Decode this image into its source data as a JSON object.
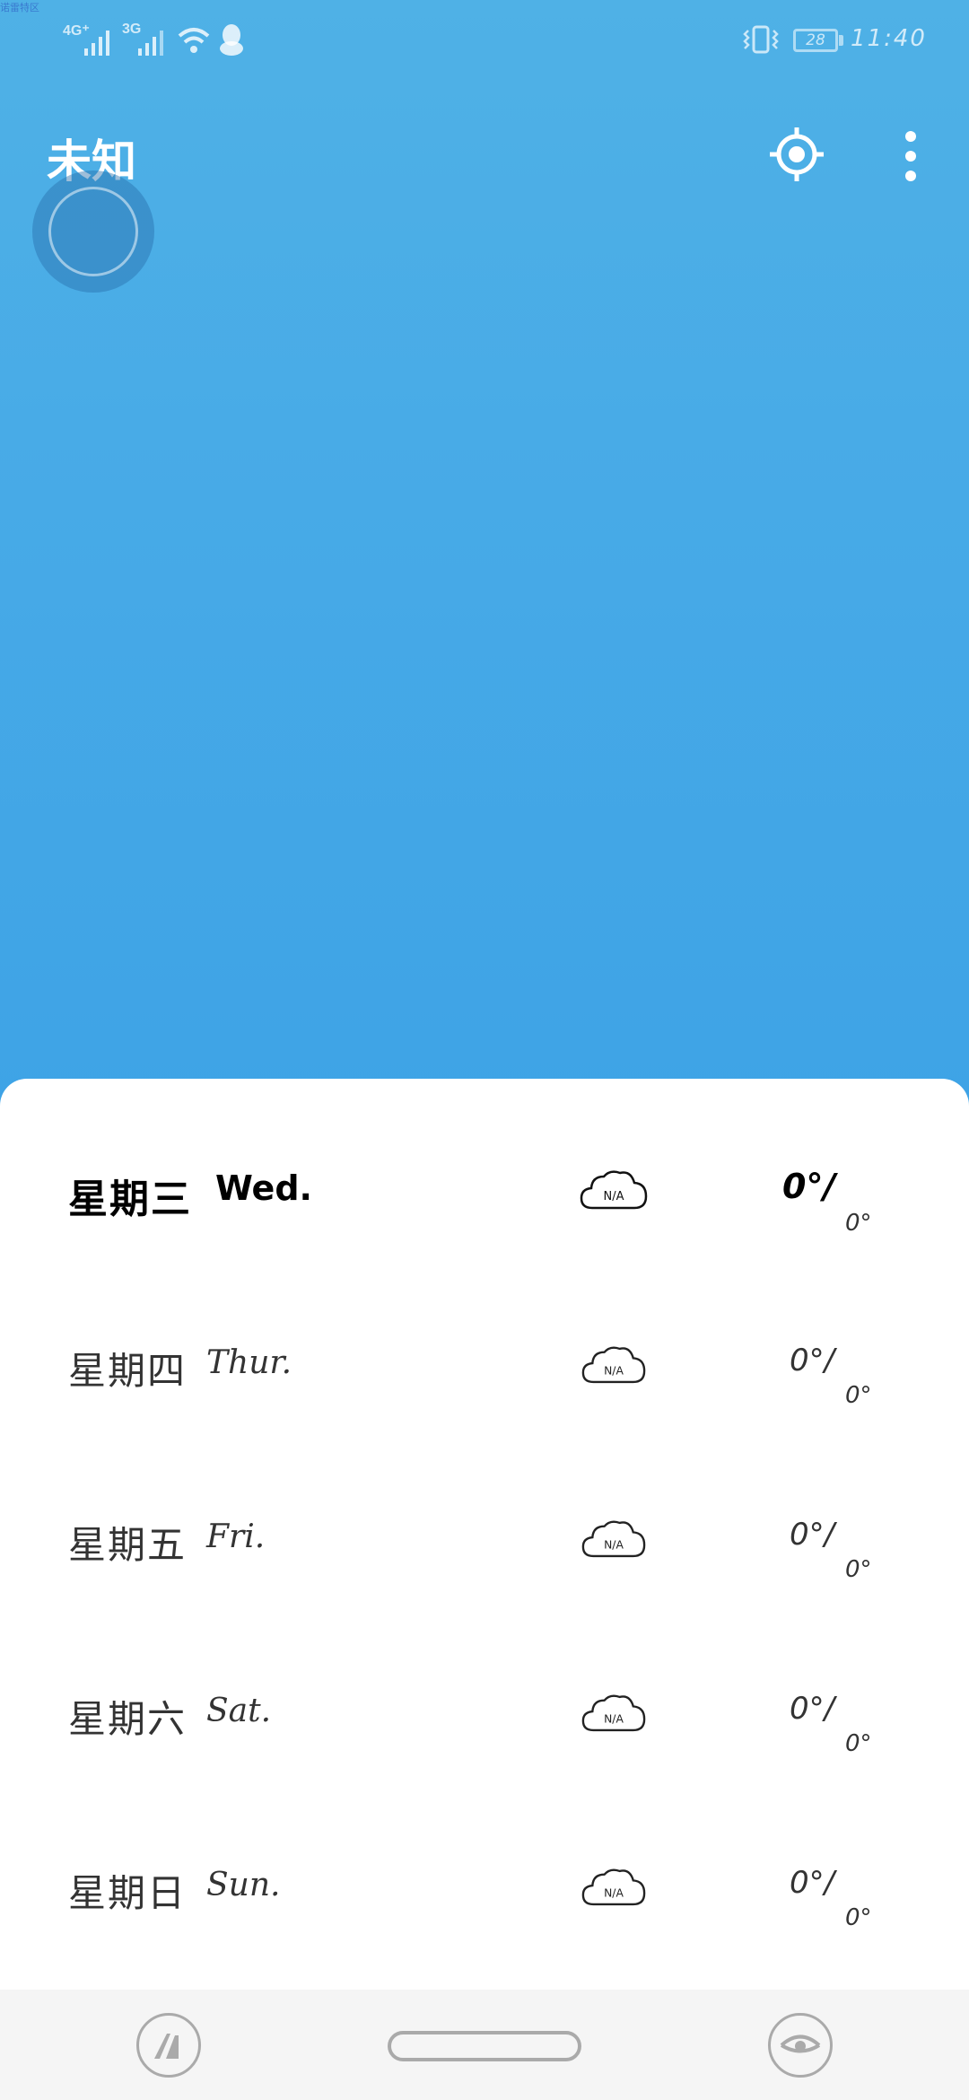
{
  "status_bar": {
    "corner_label": "诺雷特区",
    "net_1": "4G⁺",
    "net_2": "3G",
    "battery": "28",
    "time": "11:40"
  },
  "app_bar": {
    "city": "未知"
  },
  "forecast": [
    {
      "day_cn": "星期三",
      "day_en": "Wed.",
      "icon": "cloud-icon",
      "icon_text": "N/A",
      "high": "0°/",
      "low": "0°",
      "today": true
    },
    {
      "day_cn": "星期四",
      "day_en": "Thur.",
      "icon": "cloud-icon",
      "icon_text": "N/A",
      "high": "0°/",
      "low": "0°"
    },
    {
      "day_cn": "星期五",
      "day_en": "Fri.",
      "icon": "cloud-icon",
      "icon_text": "N/A",
      "high": "0°/",
      "low": "0°"
    },
    {
      "day_cn": "星期六",
      "day_en": "Sat.",
      "icon": "cloud-icon",
      "icon_text": "N/A",
      "high": "0°/",
      "low": "0°"
    },
    {
      "day_cn": "星期日",
      "day_en": "Sun.",
      "icon": "cloud-icon",
      "icon_text": "N/A",
      "high": "0°/",
      "low": "0°"
    }
  ],
  "colors": {
    "sky_top": "#4fb1e6",
    "sky_bottom": "#3ea3e6",
    "sheet": "#ffffff",
    "nav_bar": "#f5f5f5"
  }
}
